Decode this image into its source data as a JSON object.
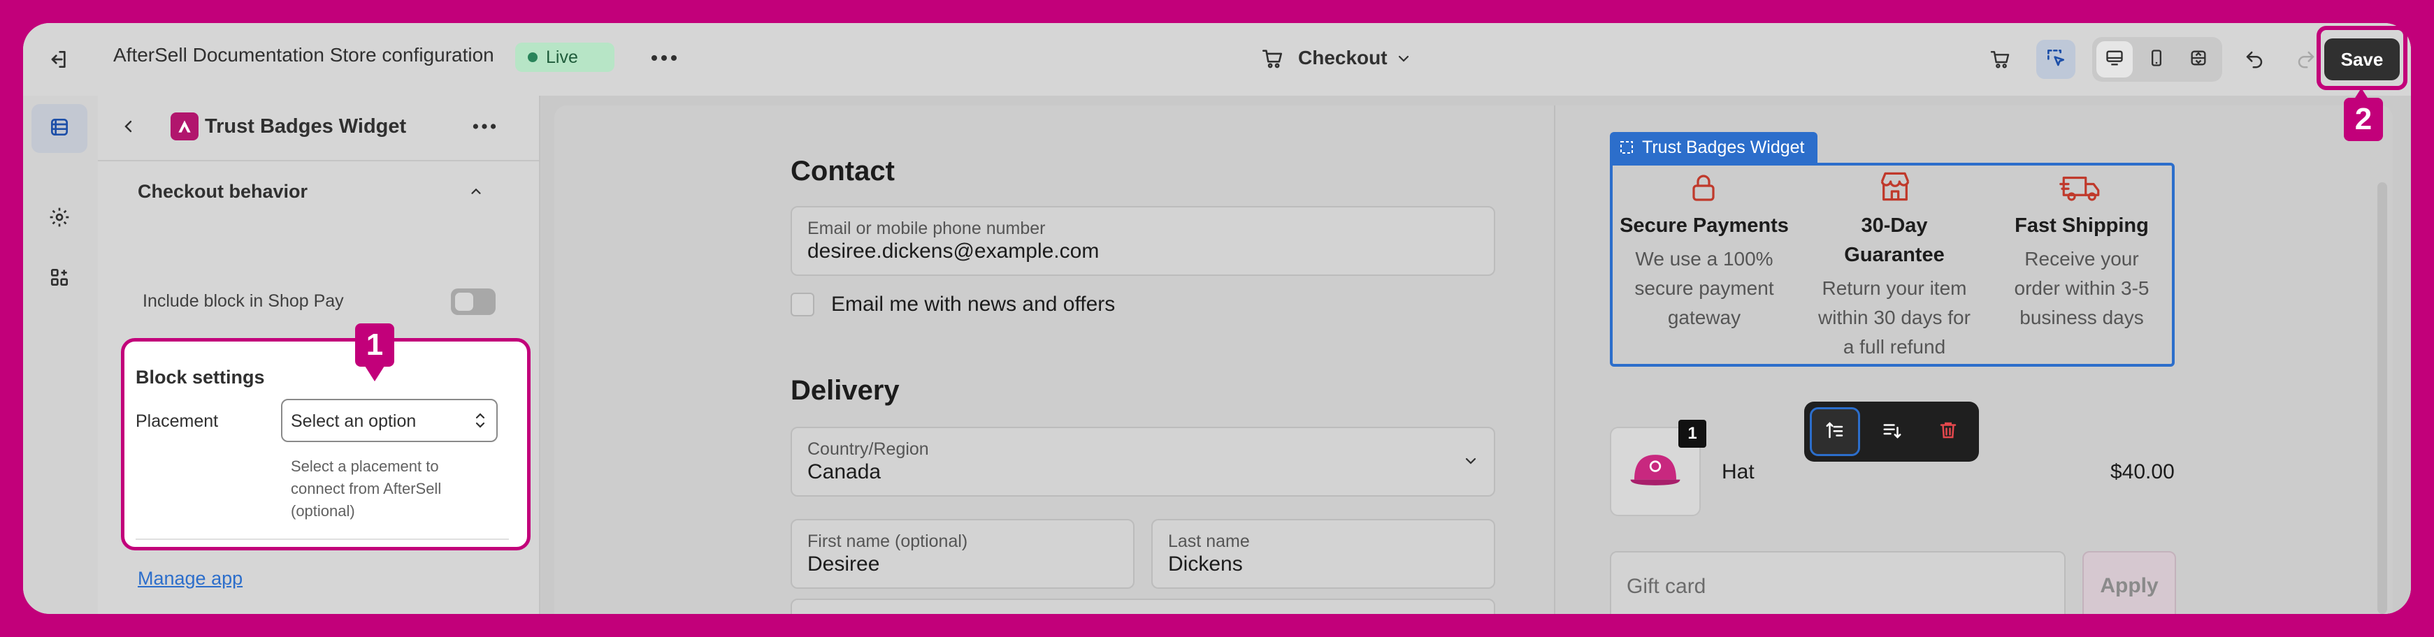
{
  "topbar": {
    "store_title": "AfterSell Documentation Store configuration",
    "live_badge": "Live",
    "page_selector": "Checkout",
    "save_label": "Save"
  },
  "sidebar": {
    "title": "Trust Badges Widget",
    "section_title": "Checkout behavior",
    "shop_pay_label": "Include block in Shop Pay",
    "shop_pay_enabled": false,
    "block_settings_title": "Block settings",
    "placement_label": "Placement",
    "placement_value": "Select an option",
    "placement_help": [
      "Select a placement to",
      "connect from AfterSell",
      "(optional)"
    ],
    "manage_app": "Manage app"
  },
  "checkout": {
    "contact_heading": "Contact",
    "email_label": "Email or mobile phone number",
    "email_value": "desiree.dickens@example.com",
    "newsletter_label": "Email me with news and offers",
    "delivery_heading": "Delivery",
    "country_label": "Country/Region",
    "country_value": "Canada",
    "first_name_label": "First name (optional)",
    "first_name_value": "Desiree",
    "last_name_label": "Last name",
    "last_name_value": "Dickens"
  },
  "widget": {
    "tag_label": "Trust Badges Widget",
    "badges": [
      {
        "icon": "lock-icon",
        "title_lines": [
          "Secure Payments"
        ],
        "desc_lines": [
          "We use a 100%",
          "secure payment",
          "gateway"
        ]
      },
      {
        "icon": "store-icon",
        "title_lines": [
          "30-Day",
          "Guarantee"
        ],
        "desc_lines": [
          "Return your item",
          "within 30 days for",
          "a full refund"
        ]
      },
      {
        "icon": "truck-icon",
        "title_lines": [
          "Fast Shipping"
        ],
        "desc_lines": [
          "Receive your",
          "order within 3-5",
          "business days"
        ]
      }
    ]
  },
  "order": {
    "item_name": "Hat",
    "item_quantity": "1",
    "item_price": "$40.00",
    "gift_card_placeholder": "Gift card",
    "apply_label": "Apply"
  },
  "annotations": {
    "step1": "1",
    "step2": "2"
  },
  "colors": {
    "annotation": "#c2007a",
    "widget_blue": "#2c6ecb",
    "live_green": "#29845a"
  }
}
